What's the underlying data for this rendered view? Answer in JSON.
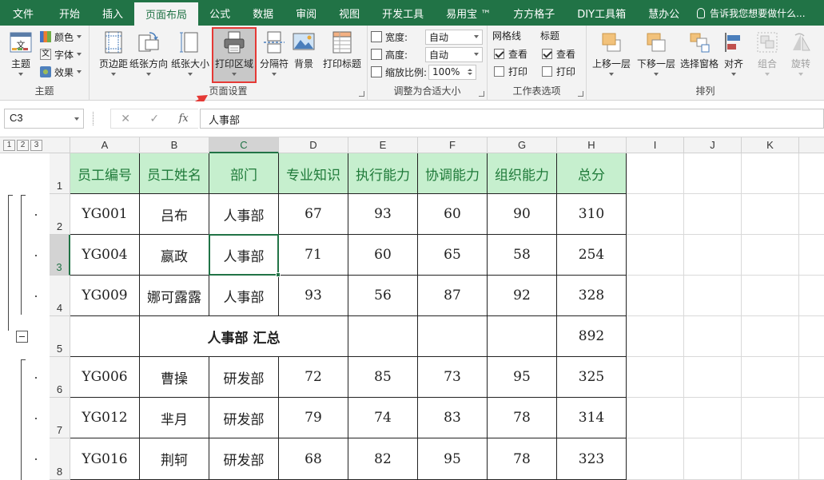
{
  "menu": {
    "tabs": [
      "文件",
      "开始",
      "插入",
      "页面布局",
      "公式",
      "数据",
      "审阅",
      "视图",
      "开发工具",
      "易用宝 ™",
      "方方格子",
      "DIY工具箱",
      "慧办公"
    ],
    "active_tab": "页面布局",
    "tell_me": "告诉我您想要做什么..."
  },
  "ribbon": {
    "theme_group": {
      "label": "主题",
      "theme_btn": "主题",
      "colors": "颜色",
      "fonts": "字体",
      "effects": "效果"
    },
    "page_setup_group": {
      "label": "页面设置",
      "margins": "页边距",
      "orientation": "纸张方向",
      "size": "纸张大小",
      "print_area": "打印区域",
      "breaks": "分隔符",
      "background": "背景",
      "print_titles": "打印标题"
    },
    "scale_group": {
      "label": "调整为合适大小",
      "width_label": "宽度:",
      "width_value": "自动",
      "height_label": "高度:",
      "height_value": "自动",
      "scale_label": "缩放比例:",
      "scale_value": "100%"
    },
    "sheet_options_group": {
      "label": "工作表选项",
      "gridlines": "网格线",
      "headings": "标题",
      "view": "查看",
      "print": "打印"
    },
    "arrange_group": {
      "label": "排列",
      "bring_forward": "上移一层",
      "send_backward": "下移一层",
      "selection_pane": "选择窗格",
      "align": "对齐",
      "group": "组合",
      "rotate": "旋转"
    }
  },
  "formula_bar": {
    "name_box": "C3",
    "cancel": "✕",
    "enter": "✓",
    "fx": "fx",
    "content": "人事部"
  },
  "outline_levels": [
    "1",
    "2",
    "3"
  ],
  "columns": [
    "A",
    "B",
    "C",
    "D",
    "E",
    "F",
    "G",
    "H",
    "I",
    "J",
    "K"
  ],
  "rows": [
    "1",
    "2",
    "3",
    "4",
    "5",
    "6",
    "7",
    "8"
  ],
  "table": {
    "headers": [
      "员工编号",
      "员工姓名",
      "部门",
      "专业知识",
      "执行能力",
      "协调能力",
      "组织能力",
      "总分"
    ],
    "data": [
      [
        "YG001",
        "吕布",
        "人事部",
        "67",
        "93",
        "60",
        "90",
        "310"
      ],
      [
        "YG004",
        "嬴政",
        "人事部",
        "71",
        "60",
        "65",
        "58",
        "254"
      ],
      [
        "YG009",
        "娜可露露",
        "人事部",
        "93",
        "56",
        "87",
        "92",
        "328"
      ]
    ],
    "subtotal": {
      "label": "人事部 汇总",
      "total": "892"
    },
    "data2": [
      [
        "YG006",
        "曹操",
        "研发部",
        "72",
        "85",
        "73",
        "95",
        "325"
      ],
      [
        "YG012",
        "芈月",
        "研发部",
        "79",
        "74",
        "83",
        "78",
        "314"
      ],
      [
        "YG016",
        "荆轲",
        "研发部",
        "68",
        "82",
        "95",
        "78",
        "323"
      ]
    ]
  },
  "colors": {
    "excel_green": "#217346",
    "header_fill": "#c6efce",
    "header_text": "#1f7a39",
    "highlight_red": "#e53935"
  }
}
